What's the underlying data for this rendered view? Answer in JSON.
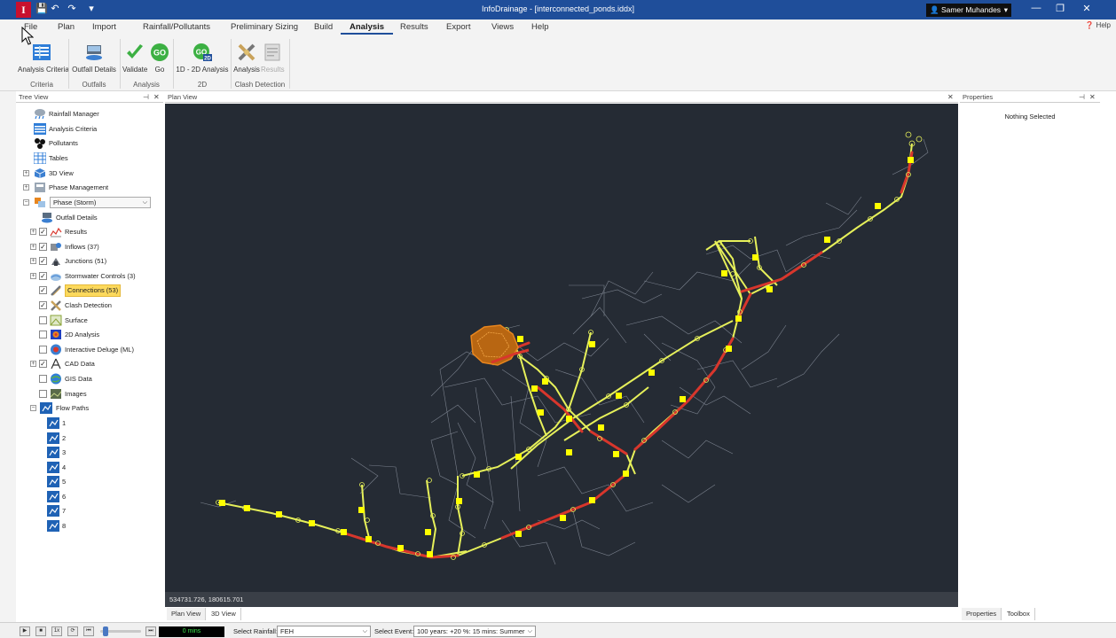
{
  "app": {
    "logo_letter": "I",
    "title": "InfoDrainage - [interconnected_ponds.iddx]",
    "user": "Samer Muhandes",
    "quick_access": {
      "save": "💾",
      "undo": "↶",
      "redo": "↷",
      "customize": "▾"
    },
    "window_controls": {
      "minimize": "—",
      "maximize": "❐",
      "close": "✕"
    }
  },
  "menu": {
    "tabs": [
      "File",
      "Plan",
      "Import",
      "Rainfall/Pollutants",
      "Preliminary Sizing",
      "Build",
      "Analysis",
      "Results",
      "Export",
      "Views",
      "Help"
    ],
    "active_tab": "Analysis",
    "help_label": "Help"
  },
  "ribbon": {
    "buttons": {
      "analysis_criteria": "Analysis Criteria",
      "outfall_details": "Outfall Details",
      "validate": "Validate",
      "go": "Go",
      "analysis_1d2d": "1D - 2D Analysis",
      "clash_analysis": "Analysis",
      "clash_results": "Results"
    },
    "go_icon_text": "GO",
    "go2d_badge": "2D",
    "groups": {
      "criteria": "Criteria",
      "outfalls": "Outfalls",
      "analysis": "Analysis",
      "twod": "2D",
      "clash": "Clash Detection"
    }
  },
  "tree_view": {
    "title": "Tree View",
    "pin": "📌",
    "close": "✕",
    "top_items": [
      "Rainfall Manager",
      "Analysis Criteria",
      "Pollutants",
      "Tables",
      "3D View",
      "Phase Management"
    ],
    "phase_combo": "Phase (Storm)",
    "outfall_details": "Outfall Details",
    "layers": [
      {
        "label": "Results",
        "checked": true,
        "expandable": true
      },
      {
        "label": "Inflows (37)",
        "checked": true,
        "expandable": true
      },
      {
        "label": "Junctions (51)",
        "checked": true,
        "expandable": true
      },
      {
        "label": "Stormwater Controls (3)",
        "checked": true,
        "expandable": true
      },
      {
        "label": "Connections (53)",
        "checked": true,
        "expandable": false,
        "highlight": true
      },
      {
        "label": "Clash Detection",
        "checked": true,
        "expandable": false
      },
      {
        "label": "Surface",
        "checked": false,
        "expandable": false
      },
      {
        "label": "2D Analysis",
        "checked": false,
        "expandable": false
      },
      {
        "label": "Interactive Deluge (ML)",
        "checked": false,
        "expandable": false
      },
      {
        "label": "CAD Data",
        "checked": true,
        "expandable": true
      },
      {
        "label": "GIS Data",
        "checked": false,
        "expandable": false
      },
      {
        "label": "Images",
        "checked": false,
        "expandable": false
      }
    ],
    "flow_paths_label": "Flow Paths",
    "flow_paths": [
      "1",
      "2",
      "3",
      "4",
      "5",
      "6",
      "7",
      "8"
    ],
    "expand_plus": "+",
    "expand_minus": "−",
    "check_mark": "✓"
  },
  "plan_view": {
    "title": "Plan View",
    "close": "✕",
    "coordinates": "534731.726, 180615.701",
    "bottom_tabs": [
      "Plan View",
      "3D View"
    ]
  },
  "properties": {
    "title": "Properties",
    "pin": "📌",
    "close": "✕",
    "message": "Nothing Selected",
    "bottom_tabs": [
      "Properties",
      "Toolbox"
    ]
  },
  "status_bar": {
    "controls": [
      "▶",
      "■",
      "1x",
      "⟳",
      "⏮",
      "⏭"
    ],
    "time_display": "0 mins",
    "select_rainfall_label": "Select Rainfall:",
    "rainfall_value": "FEH",
    "select_event_label": "Select Event:",
    "event_value": "100 years: +20 %: 15 mins: Summer",
    "dropdown_arrow": "⌵"
  },
  "colors": {
    "title_bar": "#1f4e9a",
    "plan_background": "#252b34",
    "network_yellow": "#e6f05a",
    "flow_red": "#d8362c",
    "node_yellow": "#ffff00",
    "pond_orange": "#e8861e",
    "highlight": "#fcd95c"
  }
}
